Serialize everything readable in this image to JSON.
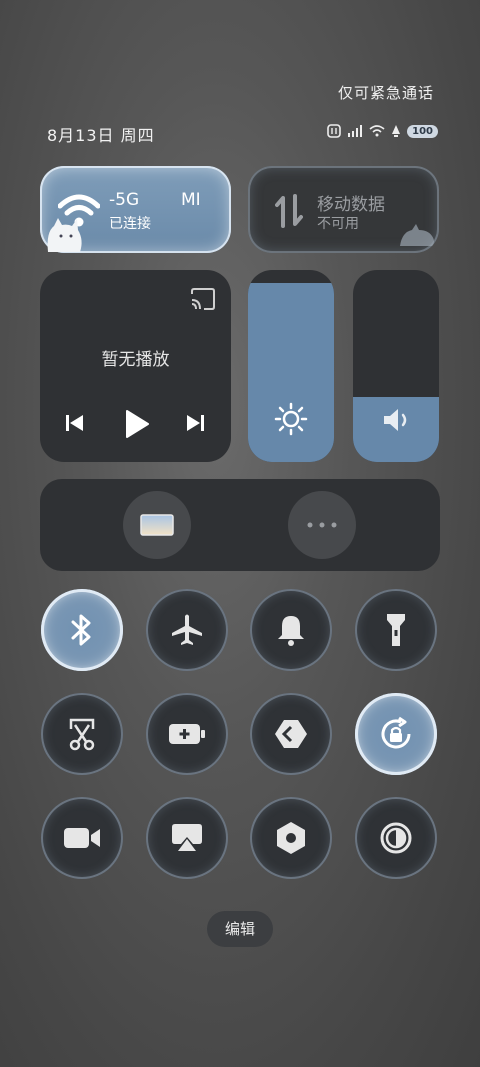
{
  "status_bar": {
    "emergency_text": "仅可紧急通话",
    "date_text": "8月13日 周四",
    "battery_level": "100"
  },
  "wifi": {
    "ssid": "-5G",
    "ssid_tail": "MI",
    "status": "已连接",
    "active": true
  },
  "mobile_data": {
    "title": "移动数据",
    "status": "不可用",
    "active": false
  },
  "media": {
    "status": "暂无播放"
  },
  "brightness": {
    "level": 0.93
  },
  "volume": {
    "level": 0.34
  },
  "toggles": [
    {
      "name": "bluetooth",
      "active": true
    },
    {
      "name": "airplane-mode",
      "active": false
    },
    {
      "name": "ring-mode",
      "active": false
    },
    {
      "name": "flashlight",
      "active": false
    },
    {
      "name": "screenshot",
      "active": false
    },
    {
      "name": "battery-saver",
      "active": false
    },
    {
      "name": "nearby-share",
      "active": false
    },
    {
      "name": "rotation-lock",
      "active": true
    },
    {
      "name": "screen-recorder",
      "active": false
    },
    {
      "name": "cast-screen",
      "active": false
    },
    {
      "name": "settings",
      "active": false
    },
    {
      "name": "dark-mode",
      "active": false
    }
  ],
  "edit_label": "编辑",
  "colors": {
    "accent": "#6688aa",
    "tile_dark": "#2f3134",
    "background": "#555555"
  }
}
